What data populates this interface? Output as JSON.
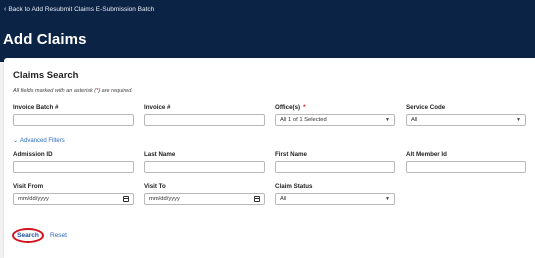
{
  "header": {
    "back_link": "Back to Add Resubmit Claims E-Submission Batch",
    "title": "Add Claims"
  },
  "claims_search": {
    "title": "Claims Search",
    "required_note_prefix": "All fields marked with an asterisk (",
    "required_note_star": "*",
    "required_note_suffix": ") are required.",
    "advanced_filters": "Advanced Filters",
    "fields": {
      "invoice_batch": {
        "label": "Invoice Batch #",
        "value": ""
      },
      "invoice": {
        "label": "Invoice #",
        "value": ""
      },
      "offices": {
        "label": "Office(s)",
        "required_star": "*",
        "value": "All 1 of 1 Selected"
      },
      "service_code": {
        "label": "Service Code",
        "value": "All"
      },
      "admission_id": {
        "label": "Admission ID",
        "value": ""
      },
      "last_name": {
        "label": "Last Name",
        "value": ""
      },
      "first_name": {
        "label": "First Name",
        "value": ""
      },
      "alt_member_id": {
        "label": "Alt Member Id",
        "value": ""
      },
      "visit_from": {
        "label": "Visit From",
        "placeholder": "mm/dd/yyyy"
      },
      "visit_to": {
        "label": "Visit To",
        "placeholder": "mm/dd/yyyy"
      },
      "claim_status": {
        "label": "Claim Status",
        "value": "All"
      }
    },
    "search_label": "Search",
    "reset_label": "Reset"
  },
  "colors": {
    "header_bg": "#0b2344",
    "link": "#2b6cc4",
    "required": "#c8102e",
    "highlight_circle": "#d3111a"
  },
  "icons": {
    "back": "chevron-left-icon",
    "advanced": "chevron-down-icon",
    "calendar": "calendar-icon",
    "select": "caret-down-icon"
  }
}
